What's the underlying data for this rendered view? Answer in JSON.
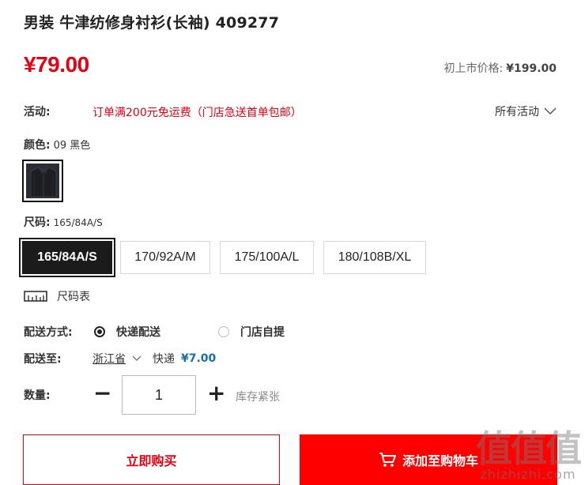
{
  "product": {
    "title": "男装 牛津纺修身衬衫(长袖) 409277",
    "price": "¥79.00",
    "original_price_label": "初上市价格:",
    "original_price": "¥199.00"
  },
  "promotion": {
    "label": "活动:",
    "text": "订单满200元免运费（门店急送首单包邮）",
    "all_label": "所有活动"
  },
  "color": {
    "label": "颜色:",
    "value": "09 黑色"
  },
  "size": {
    "label": "尺码:",
    "value": "165/84A/S",
    "options": [
      "165/84A/S",
      "170/92A/M",
      "175/100A/L",
      "180/108B/XL"
    ],
    "chart_label": "尺码表"
  },
  "shipping": {
    "method_label": "配送方式:",
    "options": [
      "快递配送",
      "门店自提"
    ],
    "to_label": "配送至:",
    "province": "浙江省",
    "carrier": "快递",
    "fee": "¥7.00"
  },
  "quantity": {
    "label": "数量:",
    "value": "1",
    "minus": "−",
    "plus": "+",
    "stock": "库存紧张"
  },
  "actions": {
    "buy_now": "立即购买",
    "add_to_cart": "添加至购物车"
  },
  "watermark": {
    "big": "值值值",
    "small": "zhizhizhi.com"
  },
  "colors": {
    "accent": "#e60012",
    "cart_bg": "#ff0000",
    "fee_color": "#1a6ea8"
  }
}
